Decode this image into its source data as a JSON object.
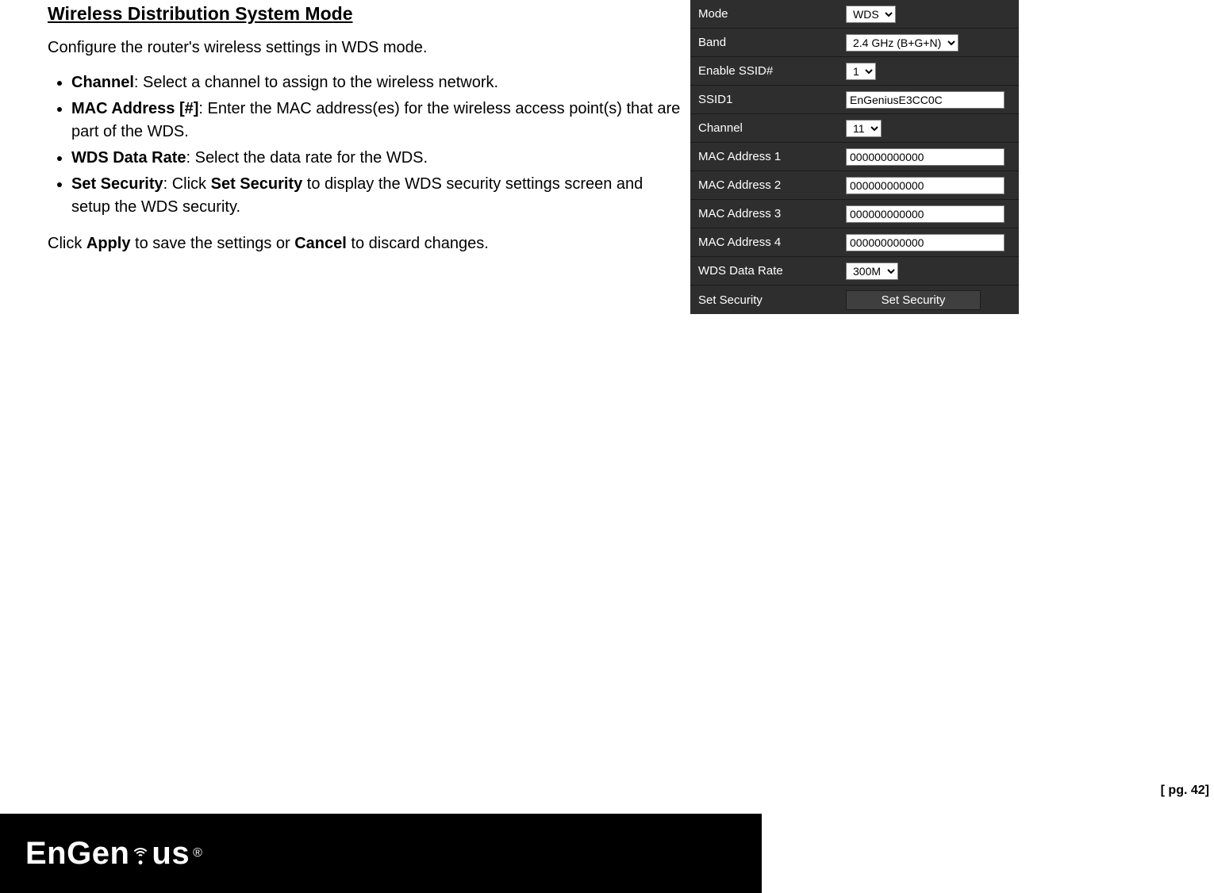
{
  "doc": {
    "heading": "Wireless Distribution System Mode",
    "intro": "Configure the router's wireless settings in WDS mode.",
    "items": [
      {
        "term": "Channel",
        "desc": ": Select a channel to assign to the wireless network."
      },
      {
        "term": "MAC Address [#]",
        "desc": ": Enter the MAC address(es) for the wireless access point(s) that are part of the WDS."
      },
      {
        "term": "WDS Data Rate",
        "desc": ": Select the data rate for the WDS."
      },
      {
        "term": "Set Security",
        "desc_pre": ": Click ",
        "desc_mid_bold": "Set Security",
        "desc_post": " to display the WDS security settings screen and setup the WDS security."
      }
    ],
    "footer_pre": "Click ",
    "footer_b1": "Apply",
    "footer_mid": " to save the settings or ",
    "footer_b2": "Cancel",
    "footer_post": " to discard changes."
  },
  "panel": {
    "labels": {
      "mode": "Mode",
      "band": "Band",
      "enable_ssid": "Enable SSID#",
      "ssid1": "SSID1",
      "channel": "Channel",
      "mac1": "MAC Address 1",
      "mac2": "MAC Address 2",
      "mac3": "MAC Address 3",
      "mac4": "MAC Address 4",
      "data_rate": "WDS Data Rate",
      "set_sec": "Set Security"
    },
    "values": {
      "mode": "WDS",
      "band": "2.4 GHz (B+G+N)",
      "enable_ssid": "1",
      "ssid1": "EnGeniusE3CC0C",
      "channel": "11",
      "mac1": "000000000000",
      "mac2": "000000000000",
      "mac3": "000000000000",
      "mac4": "000000000000",
      "data_rate": "300M",
      "set_sec_btn": "Set Security"
    }
  },
  "footer": {
    "brand_pre": "EnGen",
    "brand_post": "us",
    "reg": "®",
    "page_num": "[ pg. 42]"
  }
}
